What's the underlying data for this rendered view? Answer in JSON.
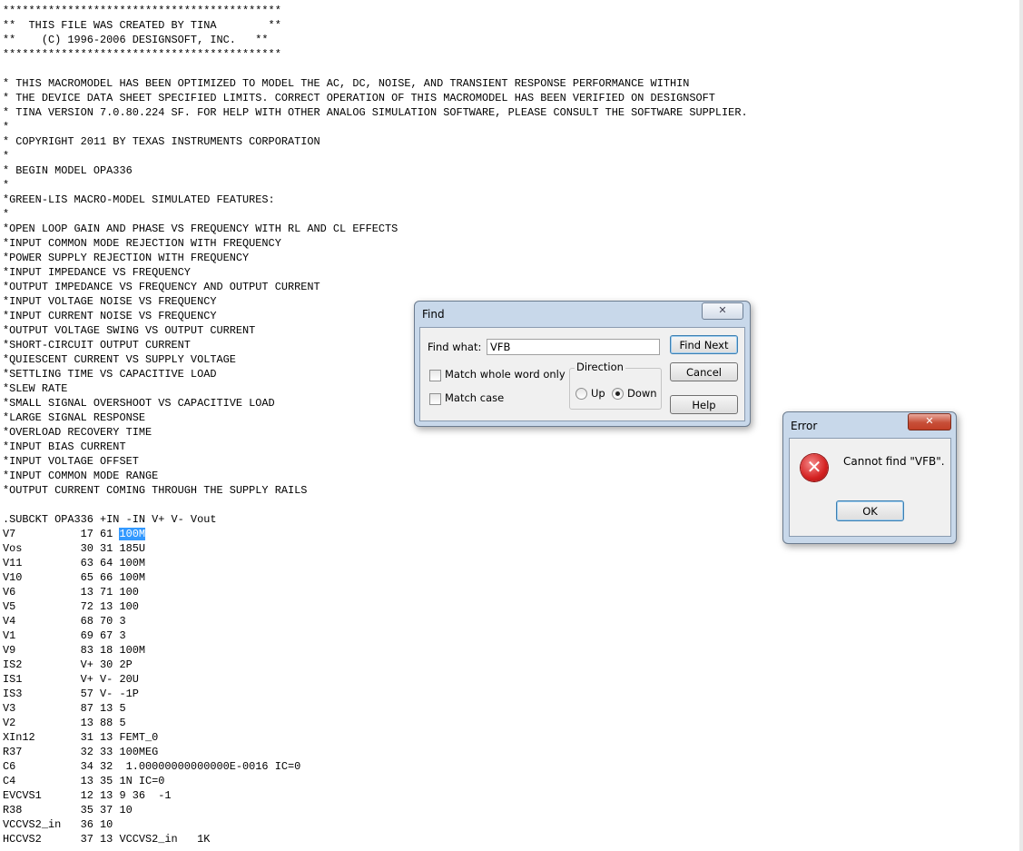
{
  "editor": {
    "lines": [
      "*******************************************",
      "**  THIS FILE WAS CREATED BY TINA        **",
      "**    (C) 1996-2006 DESIGNSOFT, INC.   **",
      "*******************************************",
      "",
      "* THIS MACROMODEL HAS BEEN OPTIMIZED TO MODEL THE AC, DC, NOISE, AND TRANSIENT RESPONSE PERFORMANCE WITHIN",
      "* THE DEVICE DATA SHEET SPECIFIED LIMITS. CORRECT OPERATION OF THIS MACROMODEL HAS BEEN VERIFIED ON DESIGNSOFT",
      "* TINA VERSION 7.0.80.224 SF. FOR HELP WITH OTHER ANALOG SIMULATION SOFTWARE, PLEASE CONSULT THE SOFTWARE SUPPLIER.",
      "*",
      "* COPYRIGHT 2011 BY TEXAS INSTRUMENTS CORPORATION",
      "*",
      "* BEGIN MODEL OPA336",
      "*",
      "*GREEN-LIS MACRO-MODEL SIMULATED FEATURES:",
      "*",
      "*OPEN LOOP GAIN AND PHASE VS FREQUENCY WITH RL AND CL EFFECTS",
      "*INPUT COMMON MODE REJECTION WITH FREQUENCY",
      "*POWER SUPPLY REJECTION WITH FREQUENCY",
      "*INPUT IMPEDANCE VS FREQUENCY",
      "*OUTPUT IMPEDANCE VS FREQUENCY AND OUTPUT CURRENT",
      "*INPUT VOLTAGE NOISE VS FREQUENCY",
      "*INPUT CURRENT NOISE VS FREQUENCY",
      "*OUTPUT VOLTAGE SWING VS OUTPUT CURRENT",
      "*SHORT-CIRCUIT OUTPUT CURRENT",
      "*QUIESCENT CURRENT VS SUPPLY VOLTAGE",
      "*SETTLING TIME VS CAPACITIVE LOAD",
      "*SLEW RATE",
      "*SMALL SIGNAL OVERSHOOT VS CAPACITIVE LOAD",
      "*LARGE SIGNAL RESPONSE",
      "*OVERLOAD RECOVERY TIME",
      "*INPUT BIAS CURRENT",
      "*INPUT VOLTAGE OFFSET",
      "*INPUT COMMON MODE RANGE",
      "*OUTPUT CURRENT COMING THROUGH THE SUPPLY RAILS",
      "",
      ".SUBCKT OPA336 +IN -IN V+ V- Vout",
      "V7          17 61 100M",
      "Vos         30 31 185U",
      "V11         63 64 100M",
      "V10         65 66 100M",
      "V6          13 71 100",
      "V5          72 13 100",
      "V4          68 70 3",
      "V1          69 67 3",
      "V9          83 18 100M",
      "IS2         V+ 30 2P",
      "IS1         V+ V- 20U",
      "IS3         57 V- -1P",
      "V3          87 13 5",
      "V2          13 88 5",
      "XIn12       31 13 FEMT_0",
      "R37         32 33 100MEG",
      "C6          34 32  1.00000000000000E-0016 IC=0",
      "C4          13 35 1N IC=0",
      "EVCVS1      12 13 9 36  -1",
      "R38         35 37 10",
      "VCCVS2_in   36 10",
      "HCCVS2      37 13 VCCVS2_in   1K"
    ],
    "selection": {
      "line": 36,
      "text": "100M"
    }
  },
  "find_dialog": {
    "title": "Find",
    "close_label": "✕",
    "find_what_label": "Find what:",
    "find_what_value": "VFB",
    "match_whole_word_label": "Match whole word only",
    "match_case_label": "Match case",
    "match_whole_word_checked": false,
    "match_case_checked": false,
    "direction_label": "Direction",
    "up_label": "Up",
    "down_label": "Down",
    "direction_selected": "down",
    "find_next_label": "Find Next",
    "cancel_label": "Cancel",
    "help_label": "Help"
  },
  "error_dialog": {
    "title": "Error",
    "close_label": "✕",
    "message": "Cannot find \"VFB\".",
    "ok_label": "OK",
    "icon": "error-icon"
  },
  "colors": {
    "selection": "#3399ff",
    "close_red": "#c74f38",
    "dialog_frame": "#c8d8ea"
  }
}
